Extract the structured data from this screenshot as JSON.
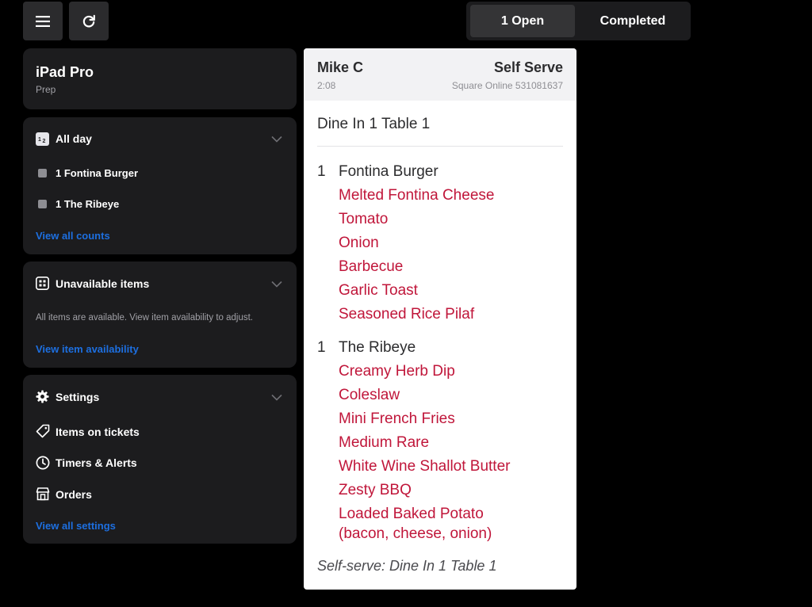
{
  "tabs": {
    "open_label": "1 Open",
    "completed_label": "Completed"
  },
  "device": {
    "name": "iPad Pro",
    "role": "Prep"
  },
  "all_day": {
    "title": "All day",
    "items": [
      {
        "label": "1 Fontina Burger"
      },
      {
        "label": "1 The Ribeye"
      }
    ],
    "link": "View all counts"
  },
  "unavailable": {
    "title": "Unavailable items",
    "message": "All items are available. View item availability to adjust.",
    "link": "View item availability"
  },
  "settings": {
    "title": "Settings",
    "items": [
      {
        "label": "Items on tickets",
        "icon": "tag-icon"
      },
      {
        "label": "Timers & Alerts",
        "icon": "clock-icon"
      },
      {
        "label": "Orders",
        "icon": "store-icon"
      }
    ],
    "link": "View all settings"
  },
  "ticket": {
    "customer": "Mike C",
    "service": "Self Serve",
    "time": "2:08",
    "source": "Square Online 531081637",
    "dining": "Dine In 1 Table 1",
    "items": [
      {
        "qty": "1",
        "name": "Fontina Burger",
        "modifiers": [
          "Melted Fontina Cheese",
          "Tomato",
          "Onion",
          "Barbecue",
          "Garlic Toast",
          "Seasoned Rice Pilaf"
        ]
      },
      {
        "qty": "1",
        "name": "The Ribeye",
        "modifiers": [
          "Creamy Herb Dip",
          "Coleslaw",
          "Mini French Fries",
          "Medium Rare",
          "White Wine Shallot Butter",
          "Zesty BBQ",
          "Loaded Baked Potato",
          "(bacon, cheese, onion)"
        ]
      }
    ],
    "footer": "Self-serve: Dine In 1 Table 1"
  },
  "colors": {
    "background": "#000000",
    "card": "#1c1c1e",
    "link_blue": "#1d6fe0",
    "modifier_red": "#c0163a"
  }
}
